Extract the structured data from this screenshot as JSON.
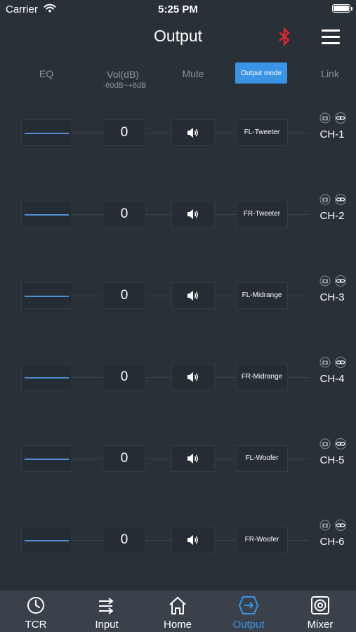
{
  "status_bar": {
    "carrier": "Carrier",
    "time": "5:25 PM"
  },
  "header": {
    "title": "Output"
  },
  "columns": {
    "eq": "EQ",
    "vol": "Vol(dB)",
    "vol_range": "-60dB~+6dB",
    "mute": "Mute",
    "output_mode": "Output mode",
    "link": "Link"
  },
  "channels": [
    {
      "eq_level": 0,
      "volume": "0",
      "mode": "FL-Tweeter",
      "name": "CH-1"
    },
    {
      "eq_level": 0,
      "volume": "0",
      "mode": "FR-Tweeter",
      "name": "CH-2"
    },
    {
      "eq_level": 0,
      "volume": "0",
      "mode": "FL-Midrange",
      "name": "CH-3"
    },
    {
      "eq_level": 0,
      "volume": "0",
      "mode": "FR-Midrange",
      "name": "CH-4"
    },
    {
      "eq_level": 0,
      "volume": "0",
      "mode": "FL-Woofer",
      "name": "CH-5"
    },
    {
      "eq_level": 0,
      "volume": "0",
      "mode": "FR-Woofer",
      "name": "CH-6"
    }
  ],
  "tabs": [
    {
      "label": "TCR",
      "icon": "clock-icon"
    },
    {
      "label": "Input",
      "icon": "input-arrows-icon"
    },
    {
      "label": "Home",
      "icon": "home-icon"
    },
    {
      "label": "Output",
      "icon": "output-icon",
      "active": true
    },
    {
      "label": "Mixer",
      "icon": "mixer-speaker-icon"
    }
  ],
  "colors": {
    "background": "#2a3038",
    "accent": "#3a94e6",
    "bluetooth": "#e0282c",
    "tab_bar": "#3a414b"
  }
}
